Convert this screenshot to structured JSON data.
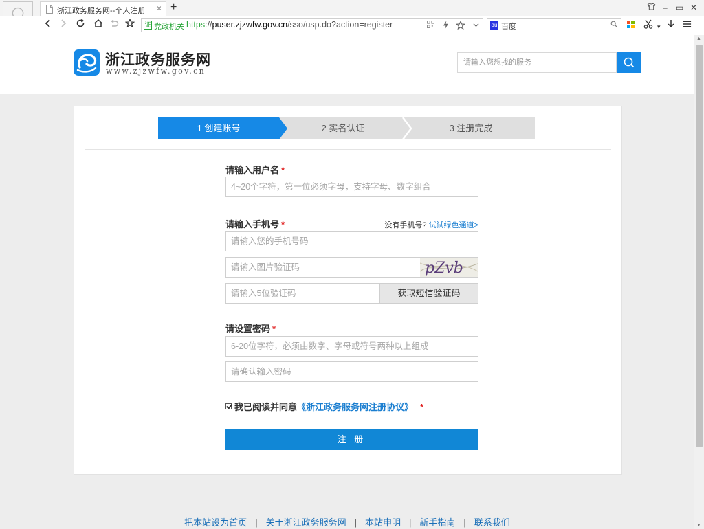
{
  "browser": {
    "tab_title": "浙江政务服务网--个人注册",
    "new_tab": "+",
    "tab_close": "×",
    "address": {
      "badge": "党政机关",
      "scheme": "https",
      "scheme_sep": "://",
      "host": "puser.zjzwfw.gov.cn",
      "path": "/sso/usp.do?action=register"
    },
    "search_engine_label": "百度",
    "window_controls": {
      "minimize": "–",
      "maximize": "▭",
      "close": "✕"
    }
  },
  "header": {
    "logo_name": "浙江政务服务网",
    "logo_url": "www.zjzwfw.gov.cn",
    "search_placeholder": "请输入您想找的服务"
  },
  "steps": [
    {
      "label": "1 创建账号",
      "active": true
    },
    {
      "label": "2 实名认证",
      "active": false
    },
    {
      "label": "3 注册完成",
      "active": false
    }
  ],
  "form": {
    "username": {
      "label": "请输入用户名",
      "required_mark": "*",
      "placeholder": "4~20个字符，第一位必须字母，支持字母、数字组合"
    },
    "phone": {
      "label": "请输入手机号",
      "required_mark": "*",
      "no_phone_text": "没有手机号?",
      "green_channel_link": "试试绿色通道>",
      "phone_placeholder": "请输入您的手机号码",
      "captcha_placeholder": "请输入图片验证码",
      "captcha_text": "pZvb",
      "sms_placeholder": "请输入5位验证码",
      "sms_button": "获取短信验证码"
    },
    "password": {
      "label": "请设置密码",
      "required_mark": "*",
      "placeholder": "6-20位字符，必须由数字、字母或符号两种以上组成",
      "confirm_placeholder": "请确认输入密码"
    },
    "agreement": {
      "checked": true,
      "text": "我已阅读并同意",
      "link": "《浙江政务服务网注册协议》",
      "required_mark": "*"
    },
    "submit": "注 册"
  },
  "footer": {
    "links": [
      "把本站设为首页",
      "关于浙江政务服务网",
      "本站申明",
      "新手指南",
      "联系我们"
    ],
    "separator": "|"
  },
  "colors": {
    "accent": "#1689e6",
    "submit": "#1187d6",
    "link": "#1a7ed0",
    "required": "#e02222",
    "secure_green": "#2aa63a"
  }
}
